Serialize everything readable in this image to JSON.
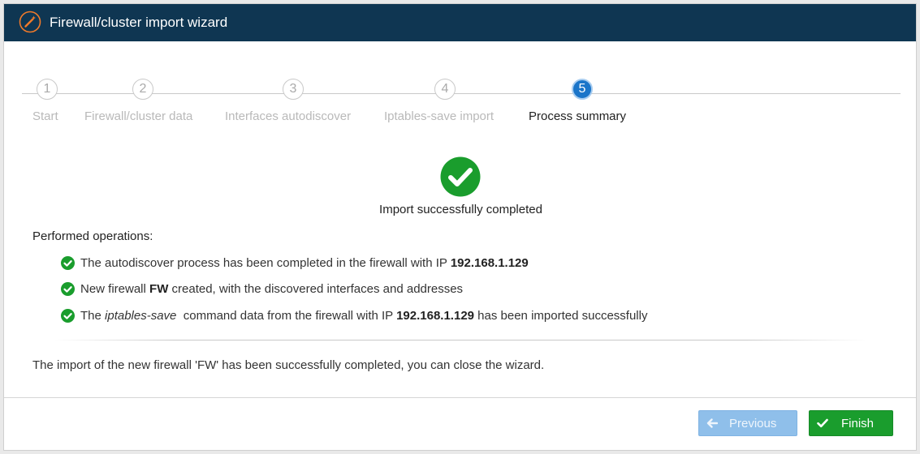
{
  "window": {
    "title": "Firewall/cluster import wizard",
    "icon": "magic-wand-icon",
    "header_color": "#0f3652",
    "icon_color": "#f07a2a"
  },
  "stepper": {
    "active_color": "#1b75c9",
    "steps": [
      {
        "number": "1",
        "label": "Start",
        "active": false
      },
      {
        "number": "2",
        "label": "Firewall/cluster data",
        "active": false
      },
      {
        "number": "3",
        "label": "Interfaces autodiscover",
        "active": false
      },
      {
        "number": "4",
        "label": "Iptables-save import",
        "active": false
      },
      {
        "number": "5",
        "label": "Process summary",
        "active": true
      }
    ]
  },
  "summary": {
    "status_icon": "check-circle-icon",
    "status_color": "#1a9d2d",
    "status_text": "Import successfully completed",
    "operations_heading": "Performed operations:",
    "operations": [
      {
        "icon": "check-circle-icon",
        "text_before": "The autodiscover process has been completed in the firewall with IP ",
        "ip": "192.168.1.129"
      },
      {
        "icon": "check-circle-icon",
        "text_before": "New firewall ",
        "name": "FW",
        "text_after": " created, with the discovered interfaces and addresses"
      },
      {
        "icon": "check-circle-icon",
        "text_before": "The ",
        "command": "iptables-save",
        "text_middle": "  command data from the firewall with IP ",
        "ip": "192.168.1.129",
        "text_after": " has been imported successfully"
      }
    ],
    "closing_text": "The import of the new firewall 'FW' has been successfully completed, you can close the wizard."
  },
  "footer": {
    "previous_label": "Previous",
    "previous_icon": "arrow-left-icon",
    "finish_label": "Finish",
    "finish_icon": "check-icon"
  }
}
